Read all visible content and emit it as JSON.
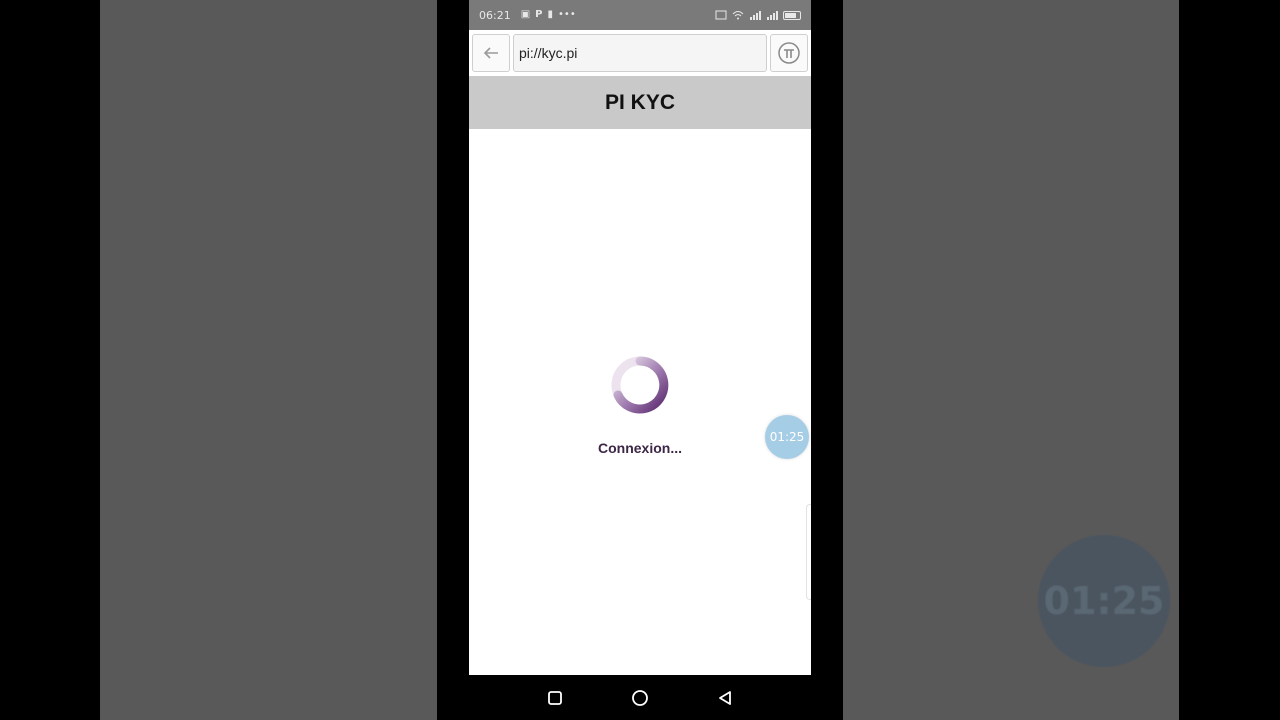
{
  "statusbar": {
    "time": "06:21",
    "left_icons": [
      "notification-icon",
      "p-icon",
      "sim-icon"
    ],
    "dots": "•••",
    "right_icons": [
      "cast-icon",
      "wifi-icon",
      "signal-icon",
      "signal-icon",
      "battery-icon"
    ]
  },
  "browser": {
    "url": "pi://kyc.pi",
    "back_icon": "arrow-left-icon",
    "pi_icon": "pi-logo-icon"
  },
  "page": {
    "title": "PI KYC",
    "loading_text": "Connexion..."
  },
  "overlay": {
    "timer": "01:25",
    "ghost_timer": "01:25"
  },
  "navigation": {
    "recent_icon": "square-icon",
    "home_icon": "circle-icon",
    "back_icon": "triangle-back-icon"
  },
  "colors": {
    "spinner_dark": "#5b2a6e",
    "spinner_light": "#e7dcea",
    "header_bg": "#c9c9c9",
    "timer_bubble": "#a6cde6"
  }
}
